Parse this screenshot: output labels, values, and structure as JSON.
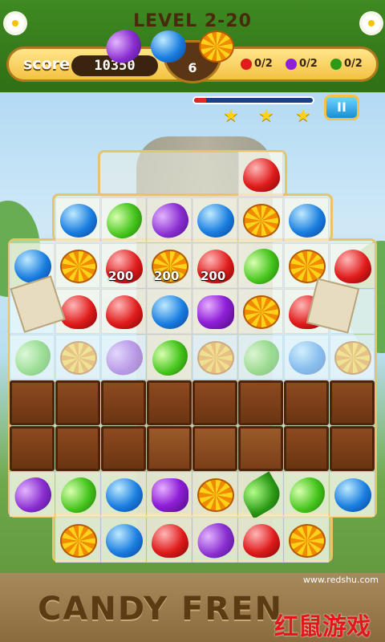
{
  "hud": {
    "level_title": "LEVEL 2-20",
    "score_label": "score",
    "score_value": "10350",
    "moves_value": "6",
    "goals": [
      {
        "icon": "strawberry-icon",
        "text": "0/2",
        "color": "#e01b1b"
      },
      {
        "icon": "grape-icon",
        "text": "0/2",
        "color": "#8f1fd8"
      },
      {
        "icon": "leaf-candy-icon",
        "text": "0/2",
        "color": "#2c9a17"
      }
    ],
    "progress_fraction": 0.1,
    "stars": 3,
    "pause_label": "II"
  },
  "board": {
    "popups": [
      "200",
      "200",
      "200"
    ],
    "rows": [
      [
        null,
        null,
        null,
        null,
        null,
        "red",
        null,
        null
      ],
      [
        null,
        "blue",
        "green",
        "purple",
        "blue",
        "orange",
        "blue",
        null
      ],
      [
        "blue",
        "orange",
        "red",
        "orange",
        "red",
        "green",
        "orange",
        "red"
      ],
      [
        "ice",
        "red",
        "red",
        "blue",
        "grape",
        "orange",
        "red",
        "ice"
      ],
      [
        "ice-green",
        "ice-orange",
        "ice-purple",
        "green",
        "ice-orange",
        "ice-green",
        "ice-blue",
        "ice-orange"
      ],
      [
        "choco",
        "choco",
        "choco",
        "choco",
        "choco",
        "choco",
        "choco",
        "choco"
      ],
      [
        "choco",
        "choco",
        "choco",
        "choco-cracked",
        "choco-cracked",
        "choco-cracked",
        "choco",
        "choco"
      ],
      [
        "purple",
        "green",
        "blue",
        "grape",
        "orange",
        "leaf",
        "green",
        "blue"
      ],
      [
        null,
        "orange",
        "blue",
        "red",
        "purple",
        "red",
        "orange",
        null
      ]
    ]
  },
  "banner": {
    "title": "CANDY FREN",
    "watermark_logo": "红鼠游戏",
    "watermark_url": "www.redshu.com"
  }
}
